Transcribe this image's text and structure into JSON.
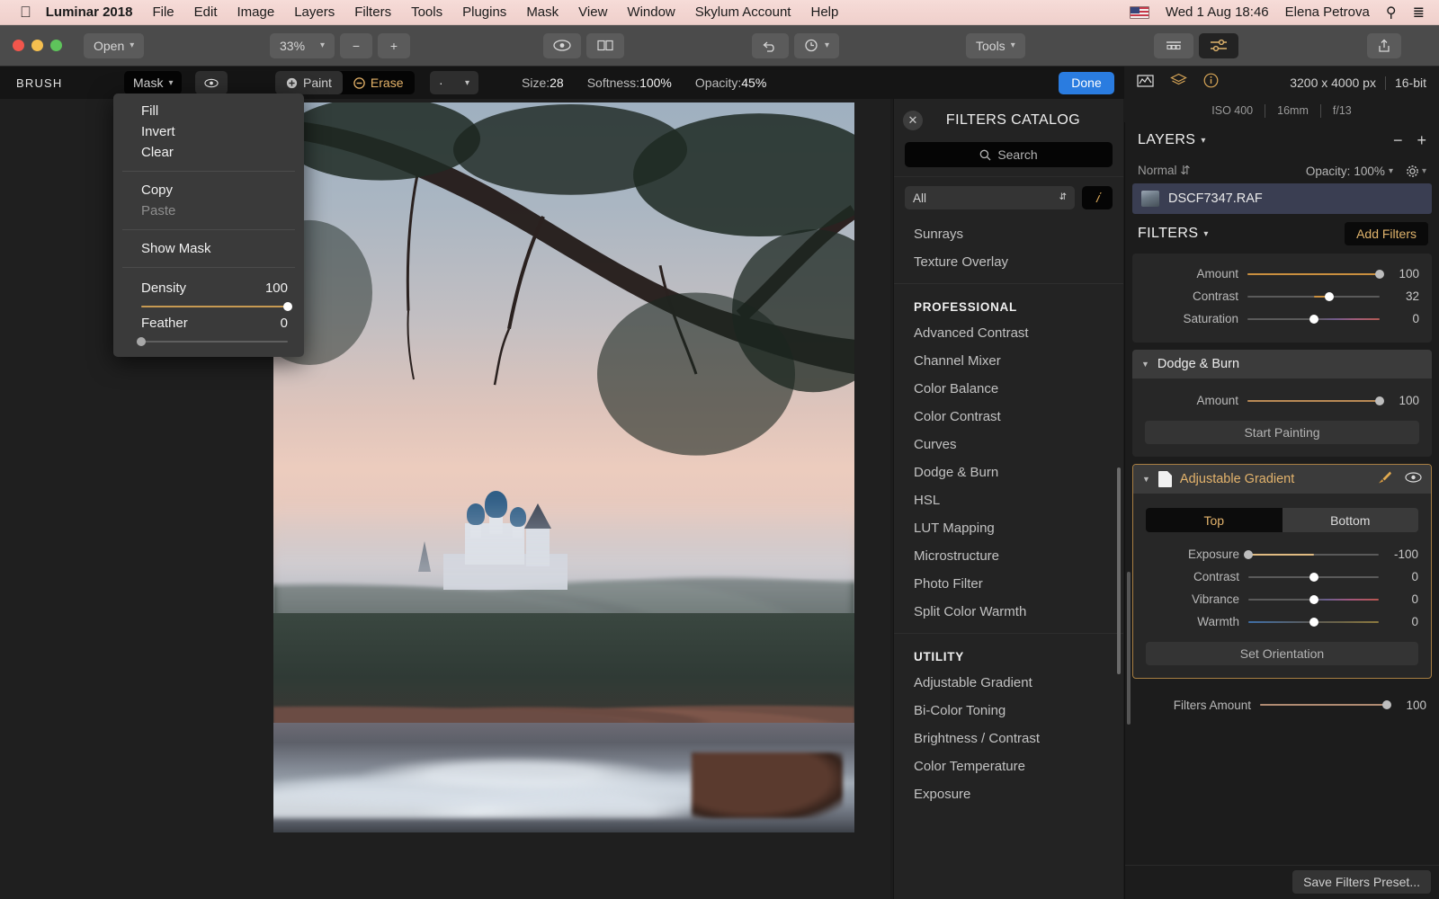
{
  "menubar": {
    "apple_icon": "apple-logo",
    "items": [
      "Luminar 2018",
      "File",
      "Edit",
      "Image",
      "Layers",
      "Filters",
      "Tools",
      "Plugins",
      "Mask",
      "View",
      "Window",
      "Skylum Account",
      "Help"
    ],
    "status": {
      "flag": "us-flag-icon",
      "datetime": "Wed 1 Aug  18:46",
      "user": "Elena Petrova",
      "search_icon": "search-icon",
      "list_icon": "control-center-icon"
    }
  },
  "toolbar": {
    "open_label": "Open",
    "zoom_value": "33%",
    "zoom_out": "−",
    "zoom_in": "+",
    "preview_icon": "eye-icon",
    "compare_icon": "split-compare-icon",
    "undo_icon": "undo-arrow-icon",
    "history_icon": "history-clock-icon",
    "tools_label": "Tools",
    "filmstrip_icon": "filmstrip-icon",
    "adjust_icon": "sliders-icon",
    "share_icon": "share-icon"
  },
  "brushbar": {
    "title": "BRUSH",
    "mask_label": "Mask",
    "visibility_icon": "eye-icon",
    "paint_label": "Paint",
    "erase_label": "Erase",
    "brush_preset": "·",
    "size_label": "Size:",
    "size_value": "28",
    "softness_label": "Softness:",
    "softness_value": "100%",
    "opacity_label": "Opacity:",
    "opacity_value": "45%",
    "done_label": "Done"
  },
  "mask_menu": {
    "items": [
      "Fill",
      "Invert",
      "Clear",
      "Copy",
      "Paste",
      "Show Mask"
    ],
    "paste_disabled": "Paste",
    "density_label": "Density",
    "density_value": "100",
    "feather_label": "Feather",
    "feather_value": "0"
  },
  "info": {
    "histogram_icon": "histogram-icon",
    "layers_icon": "layers-stack-icon",
    "info_icon": "info-circle-icon",
    "dimensions": "3200 x 4000 px",
    "bitdepth": "16-bit",
    "iso": "ISO 400",
    "focal": "16mm",
    "aperture": "f/13"
  },
  "catalog": {
    "close_icon": "close-icon",
    "title": "FILTERS CATALOG",
    "search_placeholder": "Search",
    "search_icon": "search-icon",
    "filter_select": "All",
    "info_icon": "info-circle-icon",
    "top_items": [
      "Sunrays",
      "Texture Overlay"
    ],
    "groups": [
      {
        "name": "PROFESSIONAL",
        "items": [
          "Advanced Contrast",
          "Channel Mixer",
          "Color Balance",
          "Color Contrast",
          "Curves",
          "Dodge & Burn",
          "HSL",
          "LUT Mapping",
          "Microstructure",
          "Photo Filter",
          "Split Color Warmth"
        ]
      },
      {
        "name": "UTILITY",
        "items": [
          "Adjustable Gradient",
          "Bi-Color Toning",
          "Brightness / Contrast",
          "Color Temperature",
          "Exposure"
        ]
      }
    ]
  },
  "layers": {
    "title": "LAYERS",
    "minus_icon": "minus-icon",
    "plus_icon": "plus-icon",
    "blend_mode": "Normal",
    "opacity_label": "Opacity:",
    "opacity_value": "100%",
    "gear_icon": "gear-icon",
    "layer_name": "DSCF7347.RAF"
  },
  "filters_panel": {
    "title": "FILTERS",
    "add_filters_label": "Add Filters",
    "top_sliders": [
      {
        "label": "Amount",
        "value": "100",
        "pct": 100,
        "fill": "#c98f3f",
        "knob": "grey"
      },
      {
        "label": "Contrast",
        "value": "32",
        "pct": 62,
        "fill": "#c98f3f",
        "knob": "white"
      },
      {
        "label": "Saturation",
        "value": "0",
        "pct": 50,
        "fill": "none",
        "knob": "white"
      }
    ],
    "dodge_burn": {
      "title": "Dodge & Burn",
      "amount_label": "Amount",
      "amount_value": "100",
      "amount_pct": 100,
      "button": "Start Painting"
    },
    "adjustable_gradient": {
      "title": "Adjustable Gradient",
      "brush_icon": "brush-icon",
      "eye_icon": "eye-icon",
      "doc_icon": "mask-document-icon",
      "tabs": [
        "Top",
        "Bottom"
      ],
      "active_tab": "Top",
      "sliders": [
        {
          "label": "Exposure",
          "value": "-100",
          "pct": 0,
          "knob": "white"
        },
        {
          "label": "Contrast",
          "value": "0",
          "pct": 50,
          "knob": "white"
        },
        {
          "label": "Vibrance",
          "value": "0",
          "pct": 50,
          "knob": "white"
        },
        {
          "label": "Warmth",
          "value": "0",
          "pct": 50,
          "knob": "white"
        }
      ],
      "button": "Set Orientation"
    },
    "filters_amount_label": "Filters Amount",
    "filters_amount_value": "100",
    "save_preset_label": "Save Filters Preset..."
  },
  "colors": {
    "accent": "#e3b36c",
    "blue": "#2a7ce0",
    "panel": "#1c1c1c",
    "menubar": "#f3d6d2"
  }
}
